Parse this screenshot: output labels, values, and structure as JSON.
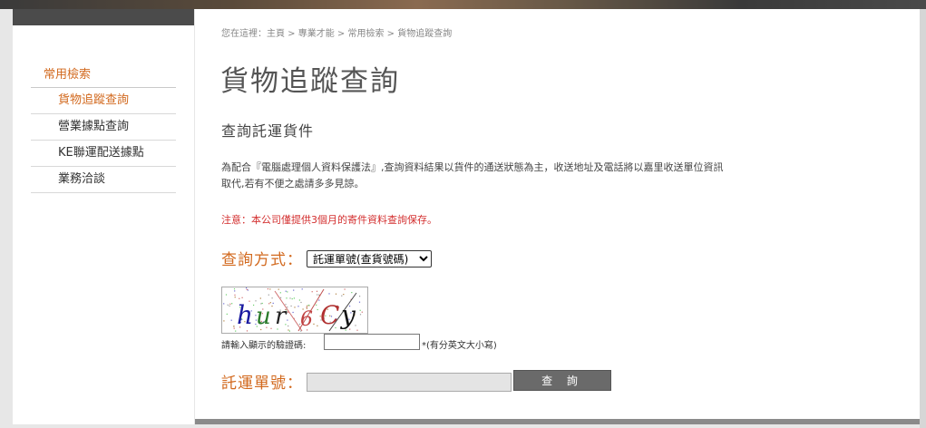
{
  "breadcrumb": "您在這裡：主頁 > 專業才能 > 常用檢索 > 貨物追蹤查詢",
  "sidebar": {
    "heading": "常用檢索",
    "items": [
      {
        "label": "貨物追蹤查詢",
        "active": true
      },
      {
        "label": "營業據點查詢",
        "active": false
      },
      {
        "label": "KE聯運配送據點",
        "active": false
      },
      {
        "label": "業務洽談",
        "active": false
      }
    ]
  },
  "main": {
    "title": "貨物追蹤查詢",
    "subtitle": "查詢託運貨件",
    "notice": "為配合『電腦處理個人資料保護法』,查詢資料結果以貨件的通送狀態為主，收送地址及電話將以嘉里收送單位資訊取代,若有不便之處請多多見諒。",
    "warning": "注意：本公司僅提供3個月的寄件資料查詢保存。",
    "query_method_label": "查詢方式：",
    "query_method_selected": "託運單號(查貨號碼)",
    "captcha": {
      "chars": [
        "h",
        "u",
        "r",
        "6",
        "C",
        "y"
      ],
      "char_colors": [
        "#1a1aa0",
        "#2a7a2a",
        "#222222",
        "#c04040",
        "#b03030",
        "#111111"
      ],
      "hint": "請輸入顯示的驗證碼:",
      "input_value": "",
      "case_note": "*(有分英文大小寫)"
    },
    "tracking_label": "託運單號：",
    "tracking_value": "",
    "query_button": "查 詢"
  },
  "colors": {
    "accent": "#d2691e",
    "warning": "#d32f2f",
    "button": "#6a6a6a"
  }
}
